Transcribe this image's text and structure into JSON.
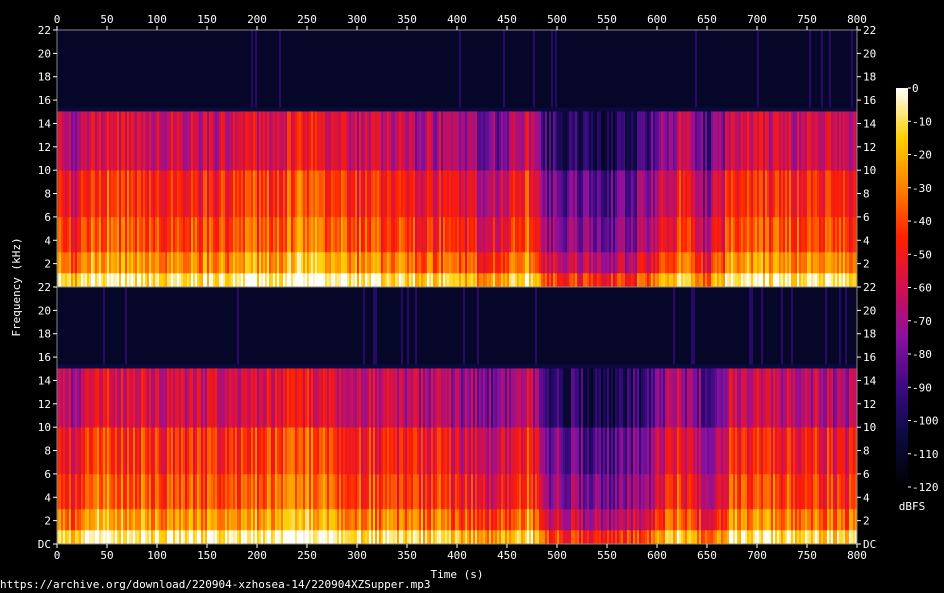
{
  "source_url": "https://archive.org/download/220904-xzhosea-14/220904XZSupper.mp3",
  "colorbar_unit": "dBFS",
  "colors": {
    "background": "#000000",
    "colormap": [
      "#000000",
      "#0a0a40",
      "#3a0a80",
      "#8a10a0",
      "#d01050",
      "#ff2000",
      "#ff8000",
      "#ffd000",
      "#ffffff"
    ]
  },
  "chart_data": {
    "type": "heatmap",
    "xlabel": "Time (s)",
    "ylabel": "Frequency (kHz)",
    "xlim": [
      0,
      800
    ],
    "x_ticks": [
      0,
      50,
      100,
      150,
      200,
      250,
      300,
      350,
      400,
      450,
      500,
      550,
      600,
      650,
      700,
      750,
      800
    ],
    "ylim": [
      0,
      22
    ],
    "y_ticks": [
      "DC",
      "2",
      "4",
      "6",
      "8",
      "10",
      "12",
      "14",
      "16",
      "18",
      "20",
      "22"
    ],
    "colorbar": {
      "label": "dBFS",
      "range": [
        -120,
        0
      ],
      "ticks": [
        "0",
        "-10",
        "-20",
        "-30",
        "-40",
        "-50",
        "-60",
        "-70",
        "-80",
        "-90",
        "-100",
        "-110",
        "-120"
      ]
    },
    "channels": [
      {
        "lowpass_cutoff_khz": 15.2,
        "energy_profile": [
          {
            "t": 0,
            "level": 0.75
          },
          {
            "t": 20,
            "level": 0.7
          },
          {
            "t": 40,
            "level": 0.85
          },
          {
            "t": 100,
            "level": 0.8
          },
          {
            "t": 180,
            "level": 0.78
          },
          {
            "t": 245,
            "level": 0.9
          },
          {
            "t": 300,
            "level": 0.78
          },
          {
            "t": 380,
            "level": 0.72
          },
          {
            "t": 440,
            "level": 0.6
          },
          {
            "t": 470,
            "level": 0.82
          },
          {
            "t": 490,
            "level": 0.45
          },
          {
            "t": 550,
            "level": 0.35
          },
          {
            "t": 590,
            "level": 0.45
          },
          {
            "t": 620,
            "level": 0.75
          },
          {
            "t": 650,
            "level": 0.5
          },
          {
            "t": 675,
            "level": 0.8
          },
          {
            "t": 720,
            "level": 0.78
          },
          {
            "t": 760,
            "level": 0.76
          },
          {
            "t": 800,
            "level": 0.7
          }
        ]
      },
      {
        "lowpass_cutoff_khz": 15.2,
        "energy_profile": [
          {
            "t": 0,
            "level": 0.75
          },
          {
            "t": 20,
            "level": 0.7
          },
          {
            "t": 40,
            "level": 0.85
          },
          {
            "t": 100,
            "level": 0.8
          },
          {
            "t": 180,
            "level": 0.78
          },
          {
            "t": 245,
            "level": 0.9
          },
          {
            "t": 300,
            "level": 0.78
          },
          {
            "t": 380,
            "level": 0.72
          },
          {
            "t": 440,
            "level": 0.6
          },
          {
            "t": 470,
            "level": 0.82
          },
          {
            "t": 490,
            "level": 0.45
          },
          {
            "t": 550,
            "level": 0.35
          },
          {
            "t": 590,
            "level": 0.45
          },
          {
            "t": 620,
            "level": 0.75
          },
          {
            "t": 650,
            "level": 0.5
          },
          {
            "t": 675,
            "level": 0.8
          },
          {
            "t": 720,
            "level": 0.78
          },
          {
            "t": 760,
            "level": 0.76
          },
          {
            "t": 800,
            "level": 0.7
          }
        ]
      }
    ]
  }
}
